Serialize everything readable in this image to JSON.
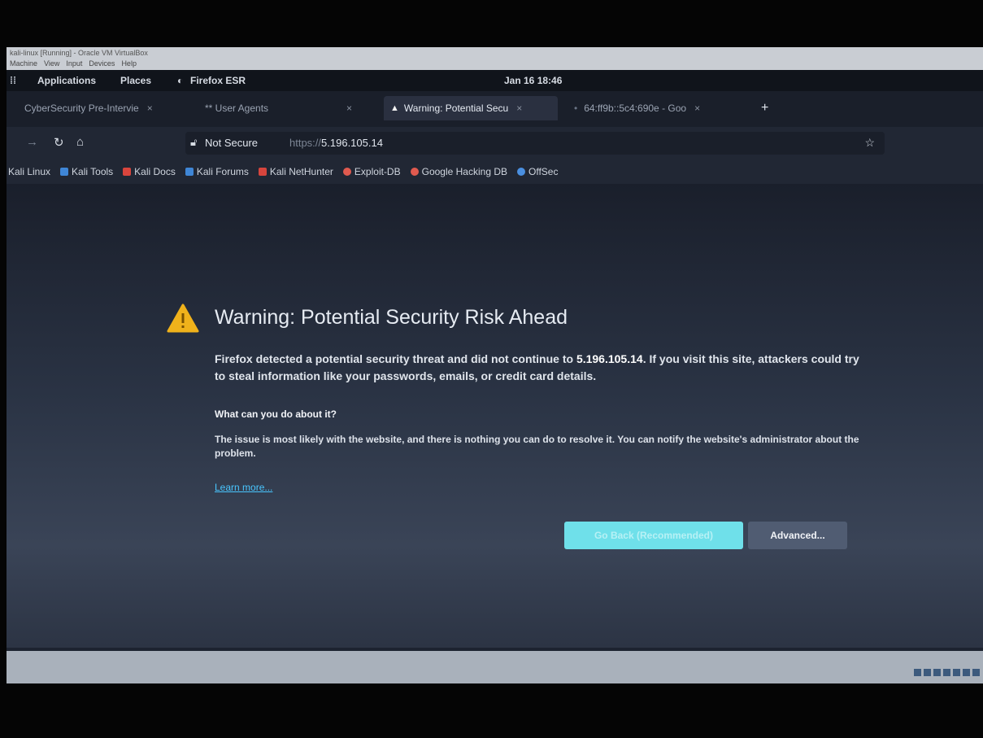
{
  "vbox": {
    "title": "kali-linux [Running] - Oracle VM VirtualBox",
    "menu": [
      "Machine",
      "View",
      "Input",
      "Devices",
      "Help"
    ]
  },
  "topbar": {
    "applications": "Applications",
    "places": "Places",
    "app_name": "Firefox ESR",
    "clock": "Jan 16 18:46"
  },
  "tabs": [
    {
      "label": "CyberSecurity Pre-Intervie",
      "close": "×"
    },
    {
      "label": "** User Agents",
      "close": "×"
    },
    {
      "label": "Warning: Potential Secu",
      "close": "×"
    },
    {
      "label": "64:ff9b::5c4:690e - Goo",
      "close": "×"
    }
  ],
  "new_tab": "+",
  "navbar": {
    "not_secure": "Not Secure",
    "url_proto": "https://",
    "url_host": "5.196.105.14"
  },
  "bookmarks": [
    {
      "label": "Kali Linux",
      "color": "#2a74c9"
    },
    {
      "label": "Kali Tools",
      "color": "#3f86d6"
    },
    {
      "label": "Kali Docs",
      "color": "#d9453d"
    },
    {
      "label": "Kali Forums",
      "color": "#3f86d6"
    },
    {
      "label": "Kali NetHunter",
      "color": "#d6453d"
    },
    {
      "label": "Exploit-DB",
      "color": "#e05a4f"
    },
    {
      "label": "Google Hacking DB",
      "color": "#e05a4f"
    },
    {
      "label": "OffSec",
      "color": "#4a8fe0"
    }
  ],
  "page": {
    "title": "Warning: Potential Security Risk Ahead",
    "para1_a": "Firefox detected a potential security threat and did not continue to ",
    "para1_host": "5.196.105.14",
    "para1_b": ". If you visit this site, attackers could try to steal information like your passwords, emails, or credit card details.",
    "subheading": "What can you do about it?",
    "para2": "The issue is most likely with the website, and there is nothing you can do to resolve it. You can notify the website's administrator about the problem.",
    "learn_more": "Learn more...",
    "go_back": "Go Back (Recommended)",
    "advanced": "Advanced..."
  },
  "colors": {
    "accent": "#6fe0ea",
    "warning": "#f0b21b"
  }
}
